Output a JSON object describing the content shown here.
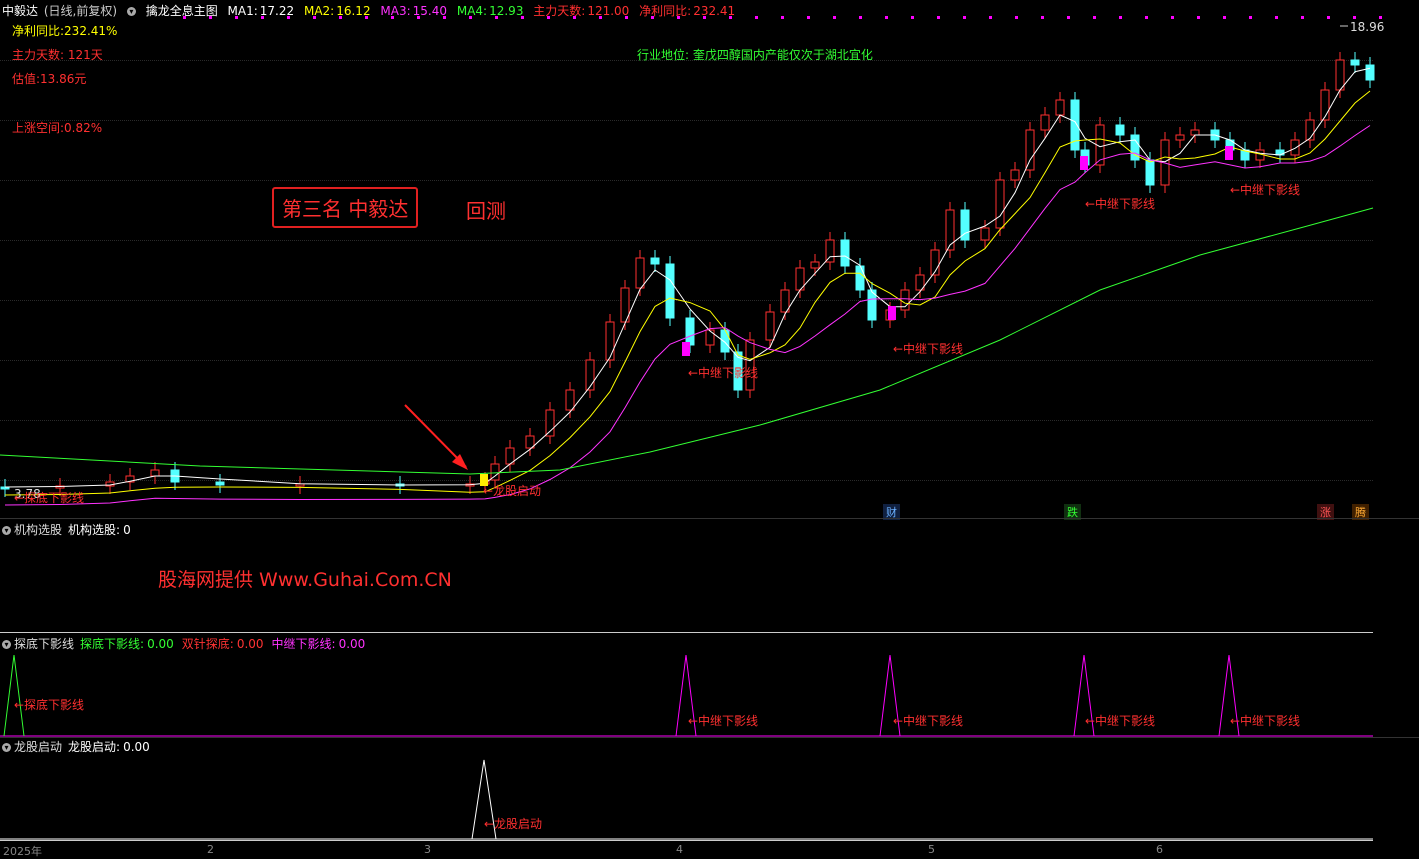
{
  "main_panel": {
    "title": "中毅达",
    "period": "(日线,前复权)",
    "indicator_name": "擒龙全息主图",
    "ma": [
      {
        "label": "MA1:",
        "value": "17.22",
        "color": "#ffffff"
      },
      {
        "label": "MA2:",
        "value": "16.12",
        "color": "#ffff00"
      },
      {
        "label": "MA3:",
        "value": "15.40",
        "color": "#ff33ff"
      },
      {
        "label": "MA4:",
        "value": "12.93",
        "color": "#33ff33"
      }
    ],
    "extra": [
      {
        "label": "主力天数:",
        "value": "121.00"
      },
      {
        "label": "净利同比:",
        "value": "232.41"
      }
    ],
    "left_info": [
      "净利同比:232.41%",
      "主力天数: 121天",
      "估值:13.86元",
      "上涨空间:0.82%"
    ],
    "industry": "行业地位: 奎戊四醇国内产能仅次于湖北宜化",
    "rank_box": "第三名 中毅达",
    "backtest": "回测",
    "high_label": "18.96",
    "low_label": "3.78",
    "annotations": {
      "dragon_start": "←龙股启动",
      "relay": "←中继下影线",
      "bottom": "←探底下影线"
    },
    "event_tags": [
      {
        "text": "财",
        "color": "#6ab0ff",
        "bg": "#102040"
      },
      {
        "text": "跌",
        "color": "#33ff33",
        "bg": "#103010"
      },
      {
        "text": "涨",
        "color": "#ff5555",
        "bg": "#401010"
      },
      {
        "text": "腾",
        "color": "#ffaa33",
        "bg": "#402000"
      }
    ]
  },
  "panel2": {
    "name": "机构选股",
    "label": "机构选股:",
    "value": "0",
    "watermark": "股海网提供 Www.Guhai.Com.CN"
  },
  "panel3": {
    "name": "探底下影线",
    "items": [
      {
        "label": "探底下影线:",
        "value": "0.00",
        "color": "#33ff33"
      },
      {
        "label": "双针探底:",
        "value": "0.00",
        "color": "#ff3333"
      },
      {
        "label": "中继下影线:",
        "value": "0.00",
        "color": "#ff33ff"
      }
    ],
    "bottom_label": "←探底下影线",
    "relay_label": "←中继下影线"
  },
  "panel4": {
    "name": "龙股启动",
    "label": "龙股启动:",
    "value": "0.00",
    "start_label": "←龙股启动"
  },
  "xaxis": [
    "2025年",
    "2",
    "3",
    "4",
    "5",
    "6"
  ],
  "colors": {
    "up": "#ff3030",
    "down": "#54ffff",
    "accent": "#ff3030",
    "relay_marker": "#ff00ff",
    "start_marker": "#ffee00"
  }
}
